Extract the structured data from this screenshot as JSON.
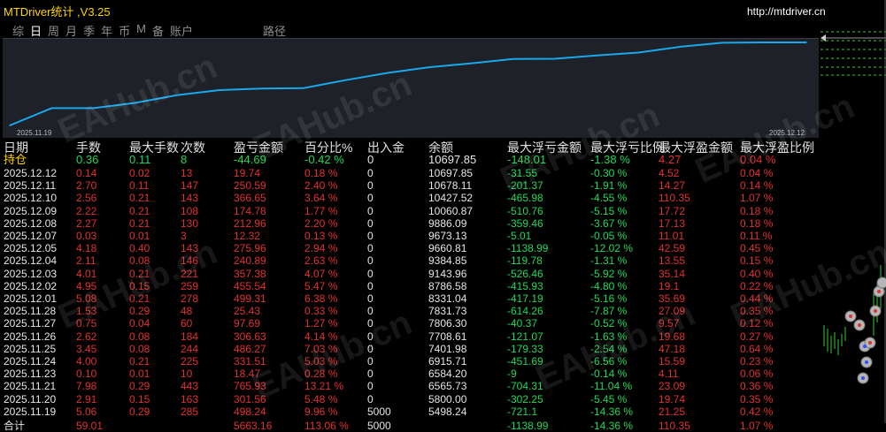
{
  "app": {
    "title": "MTDriver统计 ,V3.25",
    "url": "http://mtdriver.cn"
  },
  "tabs": [
    {
      "label": "综",
      "active": false
    },
    {
      "label": "日",
      "active": true
    },
    {
      "label": "周",
      "active": false
    },
    {
      "label": "月",
      "active": false
    },
    {
      "label": "季",
      "active": false
    },
    {
      "label": "年",
      "active": false
    },
    {
      "label": "币",
      "active": false
    },
    {
      "label": "M",
      "active": false
    },
    {
      "label": "备",
      "active": false
    },
    {
      "label": "账户",
      "active": false
    },
    {
      "label": "路径",
      "active": false
    }
  ],
  "chart": {
    "start_date": "2025.11.19",
    "end_date": "2025.12.12",
    "line_color": "#19a8ee",
    "equity": [
      5498.24,
      6584.2,
      6584.2,
      6915.71,
      7401.98,
      7708.61,
      7806.3,
      7831.73,
      8331.04,
      8786.58,
      9143.96,
      9384.85,
      9660.81,
      9673.13,
      9886.09,
      10060.87,
      10427.52,
      10678.11,
      10697.85,
      10697.85
    ]
  },
  "columns": [
    "日期",
    "手数",
    "最大手数",
    "次数",
    "盈亏金额",
    "百分比%",
    "出入金",
    "余额",
    "最大浮亏金额",
    "最大浮亏比例",
    "最大浮盈金额",
    "最大浮盈比例"
  ],
  "holding": [
    "持仓",
    "0.36",
    "0.11",
    "8",
    "-44.69",
    "-0.42 %",
    "0",
    "10697.85",
    "-148.01",
    "-1.38 %",
    "4.27",
    "0.04 %"
  ],
  "rows": [
    [
      "2025.12.12",
      "0.14",
      "0.02",
      "13",
      "19.74",
      "0.18 %",
      "0",
      "10697.85",
      "-31.55",
      "-0.30 %",
      "4.52",
      "0.04 %"
    ],
    [
      "2025.12.11",
      "2.70",
      "0.11",
      "147",
      "250.59",
      "2.40 %",
      "0",
      "10678.11",
      "-201.37",
      "-1.91 %",
      "14.27",
      "0.14 %"
    ],
    [
      "2025.12.10",
      "2.56",
      "0.21",
      "143",
      "366.65",
      "3.64 %",
      "0",
      "10427.52",
      "-465.98",
      "-4.55 %",
      "110.35",
      "1.07 %"
    ],
    [
      "2025.12.09",
      "2.22",
      "0.21",
      "108",
      "174.78",
      "1.77 %",
      "0",
      "10060.87",
      "-510.76",
      "-5.15 %",
      "17.72",
      "0.18 %"
    ],
    [
      "2025.12.08",
      "2.27",
      "0.21",
      "130",
      "212.96",
      "2.20 %",
      "0",
      "9886.09",
      "-359.46",
      "-3.67 %",
      "17.13",
      "0.18 %"
    ],
    [
      "2025.12.07",
      "0.03",
      "0.01",
      "3",
      "12.32",
      "0.13 %",
      "0",
      "9673.13",
      "-5.01",
      "-0.05 %",
      "11.01",
      "0.11 %"
    ],
    [
      "2025.12.05",
      "4.18",
      "0.40",
      "143",
      "275.96",
      "2.94 %",
      "0",
      "9660.81",
      "-1138.99",
      "-12.02 %",
      "42.59",
      "0.45 %"
    ],
    [
      "2025.12.04",
      "2.11",
      "0.08",
      "146",
      "240.89",
      "2.63 %",
      "0",
      "9384.85",
      "-119.78",
      "-1.31 %",
      "13.55",
      "0.15 %"
    ],
    [
      "2025.12.03",
      "4.01",
      "0.21",
      "221",
      "357.38",
      "4.07 %",
      "0",
      "9143.96",
      "-526.46",
      "-5.92 %",
      "35.14",
      "0.40 %"
    ],
    [
      "2025.12.02",
      "4.95",
      "0.15",
      "259",
      "455.54",
      "5.47 %",
      "0",
      "8786.58",
      "-415.93",
      "-4.80 %",
      "19.1",
      "0.22 %"
    ],
    [
      "2025.12.01",
      "5.08",
      "0.21",
      "278",
      "499.31",
      "6.38 %",
      "0",
      "8331.04",
      "-417.19",
      "-5.16 %",
      "35.69",
      "0.44 %"
    ],
    [
      "2025.11.28",
      "1.53",
      "0.29",
      "48",
      "25.43",
      "0.33 %",
      "0",
      "7831.73",
      "-614.26",
      "-7.87 %",
      "27.09",
      "0.35 %"
    ],
    [
      "2025.11.27",
      "0.75",
      "0.04",
      "60",
      "97.69",
      "1.27 %",
      "0",
      "7806.30",
      "-40.37",
      "-0.52 %",
      "9.57",
      "0.12 %"
    ],
    [
      "2025.11.26",
      "2.62",
      "0.08",
      "184",
      "306.63",
      "4.14 %",
      "0",
      "7708.61",
      "-121.07",
      "-1.63 %",
      "19.68",
      "0.27 %"
    ],
    [
      "2025.11.25",
      "3.45",
      "0.08",
      "244",
      "486.27",
      "7.03 %",
      "0",
      "7401.98",
      "-179.33",
      "-2.54 %",
      "47.18",
      "0.64 %"
    ],
    [
      "2025.11.24",
      "4.00",
      "0.21",
      "225",
      "331.51",
      "5.03 %",
      "0",
      "6915.71",
      "-451.69",
      "-6.56 %",
      "15.59",
      "0.23 %"
    ],
    [
      "2025.11.23",
      "0.10",
      "0.01",
      "10",
      "18.47",
      "0.28 %",
      "0",
      "6584.20",
      "-9",
      "-0.14 %",
      "4.11",
      "0.06 %"
    ],
    [
      "2025.11.21",
      "7.98",
      "0.29",
      "443",
      "765.93",
      "13.21 %",
      "0",
      "6565.73",
      "-704.31",
      "-11.04 %",
      "23.09",
      "0.36 %"
    ],
    [
      "2025.11.20",
      "2.91",
      "0.15",
      "163",
      "301.56",
      "5.48 %",
      "0",
      "5800.00",
      "-302.25",
      "-5.45 %",
      "19.74",
      "0.35 %"
    ],
    [
      "2025.11.19",
      "5.06",
      "0.29",
      "285",
      "498.24",
      "9.96 %",
      "5000",
      "5498.24",
      "-721.1",
      "-14.36 %",
      "21.25",
      "0.42 %"
    ]
  ],
  "total": [
    "合计",
    "59.01",
    "",
    "",
    "5663.16",
    "113.06 %",
    "5000",
    "",
    "-1138.99",
    "-14.36 %",
    "110.35",
    "1.07 %"
  ],
  "watermark": "EAHub.cn"
}
